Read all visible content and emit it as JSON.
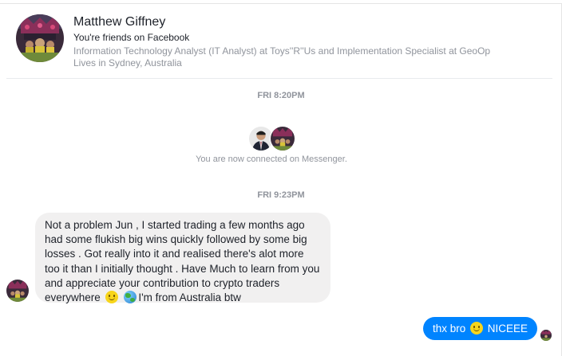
{
  "header": {
    "name": "Matthew Giffney",
    "friends": "You're friends on Facebook",
    "work": "Information Technology Analyst (IT Analyst) at Toys''R''Us and Implementation Specialist at GeoOp",
    "lives": "Lives in Sydney, Australia"
  },
  "conversation": {
    "timestamp_1": "FRI 8:20PM",
    "connected": "You are now connected on Messenger.",
    "timestamp_2": "FRI 9:23PM",
    "incoming": {
      "text_part_1": "Not a problem Jun , I started trading a few months ago had some flukish big wins quickly followed by some big losses . Got really into it and realised there's alot more too it than I initially thought . Have Much to learn from you and appreciate your contribution to crypto traders everywhere ",
      "text_part_2": "I'm from Australia btw",
      "emojis": [
        "slightly-smiling-face-icon",
        "globe-icon"
      ]
    },
    "outgoing": {
      "text_part_1": "thx bro ",
      "text_part_2": " NICEEE",
      "emoji": "slightly-smiling-face-icon"
    }
  },
  "colors": {
    "outgoing_bubble": "#0084ff",
    "incoming_bubble": "#f1f0f0",
    "muted_text": "#90949c"
  }
}
